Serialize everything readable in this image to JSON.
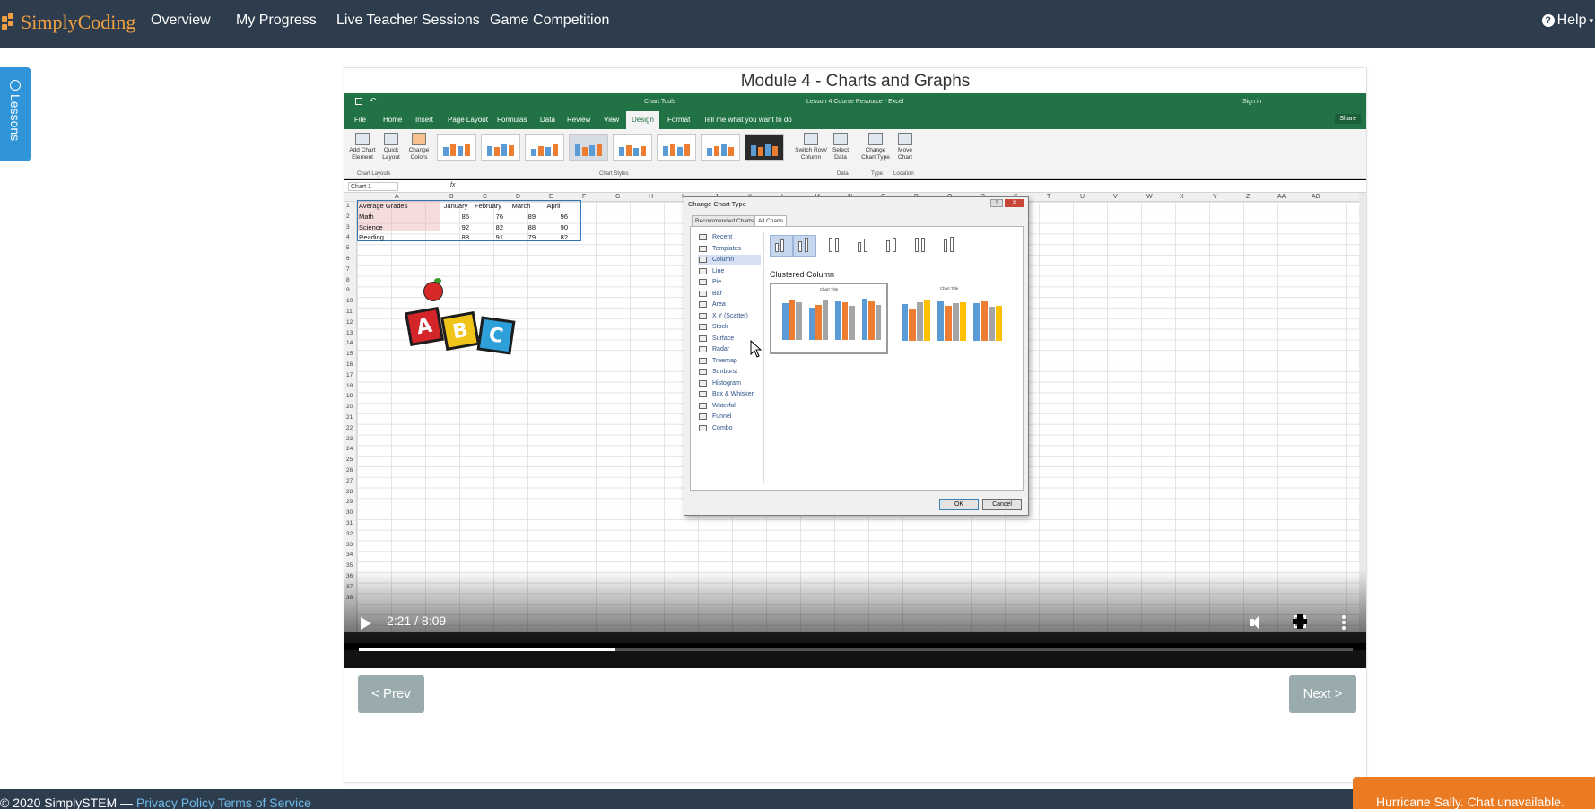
{
  "nav": {
    "brand": "SimplyCoding",
    "items": [
      "Overview",
      "My Progress",
      "Live Teacher Sessions",
      "Game Competition"
    ],
    "help": "Help"
  },
  "lessons_tab": "Lessons",
  "module": {
    "title": "Module 4 - Charts and Graphs",
    "prev_label": "< Prev",
    "next_label": "Next >"
  },
  "video": {
    "time": "2:21 / 8:09",
    "progress": 0.258,
    "excel": {
      "title": "Lesson 4 Course Resource - Excel",
      "chart_tools": "Chart Tools",
      "sign_in": "Sign in",
      "share": "Share",
      "tabs": [
        "File",
        "Home",
        "Insert",
        "Page Layout",
        "Formulas",
        "Data",
        "Review",
        "View",
        "Design",
        "Format"
      ],
      "tell_me": "Tell me what you want to do",
      "ribbon_buttons": {
        "add_chart_element": "Add Chart Element",
        "quick_layout": "Quick Layout",
        "change_colors": "Change Colors",
        "switch_row_column": "Switch Row/ Column",
        "select_data": "Select Data",
        "change_chart_type": "Change Chart Type",
        "move_chart": "Move Chart"
      },
      "ribbon_groups": [
        "Chart Layouts",
        "Chart Styles",
        "Data",
        "Type",
        "Location"
      ],
      "name_box": "Chart 1",
      "columns": [
        "A",
        "B",
        "C",
        "D",
        "E",
        "F",
        "G",
        "H",
        "I",
        "J",
        "K",
        "L",
        "M",
        "N",
        "O",
        "P",
        "Q",
        "R",
        "S",
        "T",
        "U",
        "V",
        "W",
        "X",
        "Y",
        "Z",
        "AA",
        "AB"
      ],
      "table": {
        "header": [
          "Average Grades",
          "January",
          "February",
          "March",
          "April"
        ],
        "rows": [
          [
            "Math",
            "85",
            "76",
            "89",
            "96"
          ],
          [
            "Science",
            "92",
            "82",
            "88",
            "90"
          ],
          [
            "Reading",
            "88",
            "91",
            "79",
            "82"
          ]
        ]
      },
      "abc_letters": [
        "A",
        "B",
        "C"
      ],
      "dialog": {
        "title": "Change Chart Type",
        "tabs": [
          "Recommended Charts",
          "All Charts"
        ],
        "chart_types": [
          "Recent",
          "Templates",
          "Column",
          "Line",
          "Pie",
          "Bar",
          "Area",
          "X Y (Scatter)",
          "Stock",
          "Surface",
          "Radar",
          "Treemap",
          "Sunburst",
          "Histogram",
          "Box & Whisker",
          "Waterfall",
          "Funnel",
          "Combo"
        ],
        "selected_type": "Column",
        "subtype_label": "Clustered Column",
        "preview_title": "Chart Title",
        "ok": "OK",
        "cancel": "Cancel"
      }
    }
  },
  "footer": {
    "copyright": "© 2020 SimplySTEM  —",
    "privacy": "Privacy Policy",
    "terms": "Terms of Service"
  },
  "chat_banner": "Hurricane Sally. Chat unavailable."
}
